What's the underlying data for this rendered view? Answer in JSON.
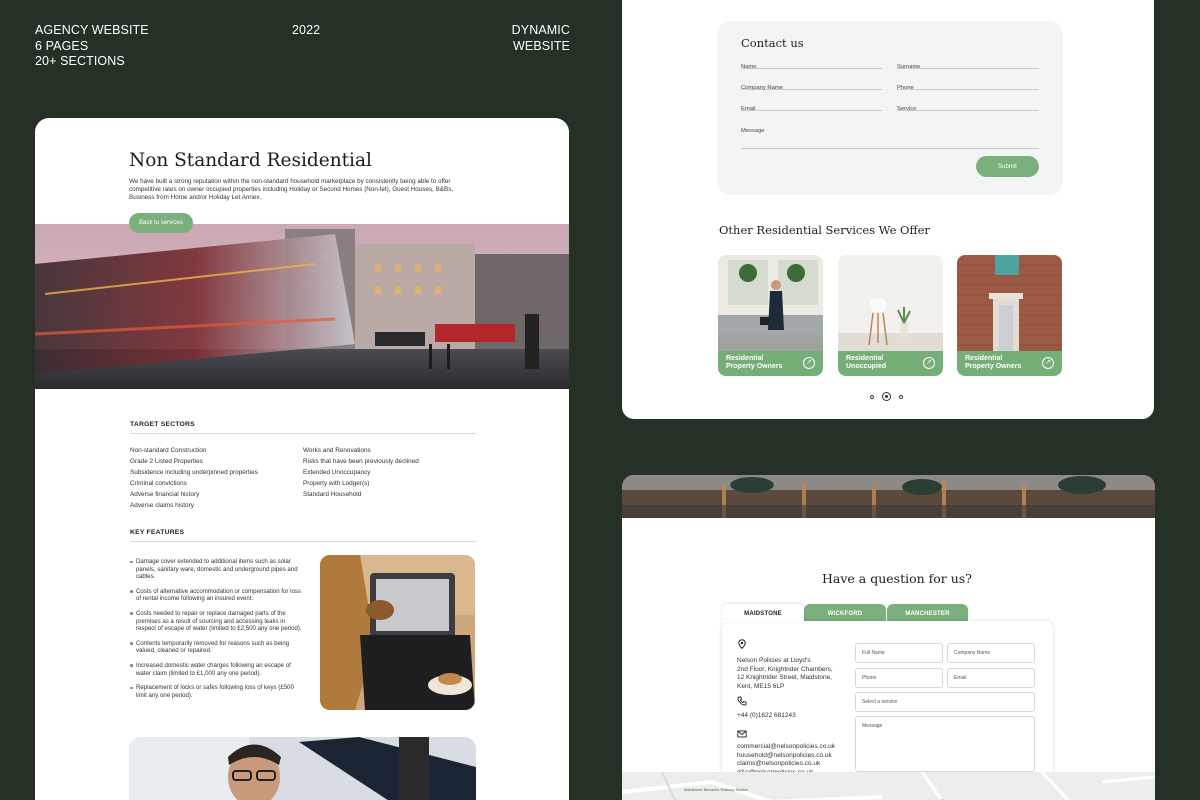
{
  "header": {
    "left_lines": [
      "AGENCY WEBSITE",
      "6 PAGES",
      "20+ SECTIONS"
    ],
    "year": "2022",
    "right_lines": [
      "DYNAMIC",
      "WEBSITE"
    ]
  },
  "residential_page": {
    "title": "Non Standard Residential",
    "intro": "We have built a strong reputation within the non-standard household marketplace by consistently being able to offer competitive rates on owner occupied properties including Holiday or Second Homes (Non-let), Guest Houses, B&Bs, Business from Home and/or Holiday Let Annex.",
    "back_button": "Back to services",
    "target_sectors_heading": "TARGET SECTORS",
    "sectors_left": [
      "Non-standard Construction",
      "Grade 2 Listed Properties",
      "Subsidence including underpinned properties",
      "Criminal convictions",
      "Adverse financial history",
      "Adverse claims history"
    ],
    "sectors_right": [
      "Works and Renovations",
      "Risks that have been previously declined",
      "Extended Unoccupancy",
      "Property with Lodger(s)",
      "Standard Household"
    ],
    "key_features_heading": "KEY FEATURES",
    "features": [
      "Damage cover extended to additional items such as solar panels, sanitary ware, domestic and underground pipes and cables.",
      "Costs of alternative accommodation or compensation for loss of rental income following an insured event.",
      "Costs needed to repair or replace damaged parts of the premises as a result of sourcing and accessing leaks in respect of escape of water (limited to £2,500 any one period).",
      "Contents temporarily removed for reasons such as being valued, cleaned or repaired.",
      "Increased domestic water charges following an escape of water claim (limited to £1,000 any one period).",
      "Replacement of locks or safes following loss of keys (£500 limit any one period)."
    ]
  },
  "contact_form": {
    "title": "Contact us",
    "fields": [
      "Name",
      "Surname",
      "Company Name",
      "Phone",
      "Email",
      "Service",
      "Message"
    ],
    "submit": "Submit"
  },
  "other_services": {
    "title": "Other Residential Services We Offer",
    "cards": [
      {
        "label_1": "Residential",
        "label_2": "Property Owners"
      },
      {
        "label_1": "Residential",
        "label_2": "Unoccupied"
      },
      {
        "label_1": "Residential",
        "label_2": "Property Owners"
      }
    ],
    "arrow": "↗"
  },
  "question_section": {
    "title": "Have a question for us?",
    "tabs": [
      "MAIDSTONE",
      "WICKFORD",
      "MANCHESTER"
    ],
    "address_lines": [
      "Nelson Policies at Lloyd's",
      "2nd Floor, Knightrider Chambers,",
      "12 Knightrider Street, Maidstone,",
      "Kent, ME15 6LP"
    ],
    "phone": "+44 (0)1622 681243",
    "emails": [
      "commercial@nelsonpolicies.co.uk",
      "household@nelsonpolicies.co.uk",
      "claims@nelsonpolicies.co.uk",
      "d&o@nelsonpolicies.co.uk"
    ],
    "form": {
      "full_name": "Full Name",
      "company_name": "Company Name",
      "phone": "Phone",
      "email": "Email",
      "service": "Select a service",
      "message": "Message"
    },
    "map_label": "Maidstone Barracks Railway Station"
  },
  "colors": {
    "background": "#253125",
    "accent_green": "#7bb07d",
    "card": "#ffffff"
  }
}
